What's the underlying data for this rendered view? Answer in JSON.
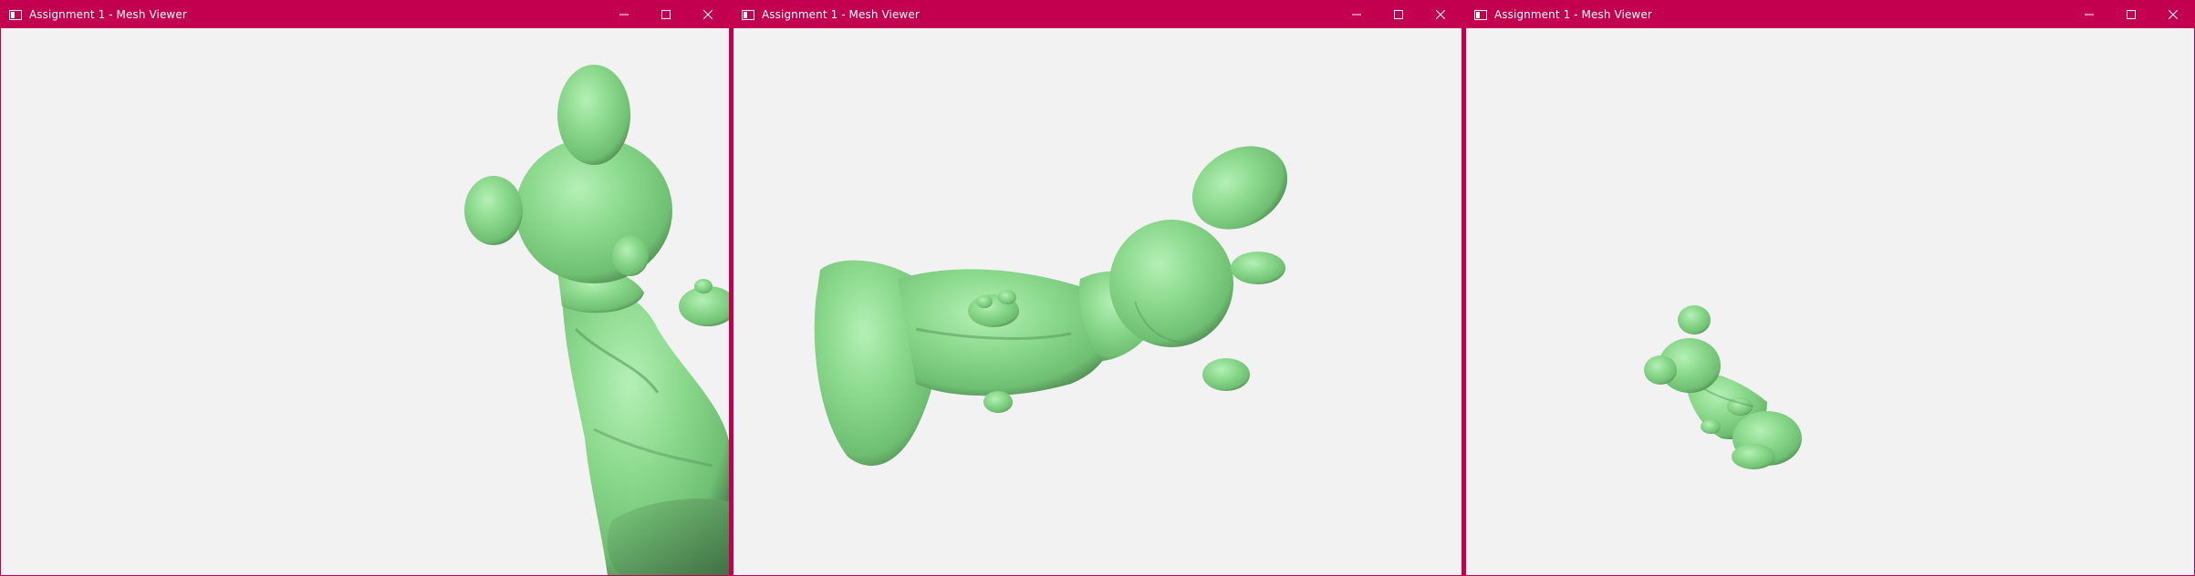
{
  "windows": [
    {
      "title": "Assignment 1 - Mesh Viewer"
    },
    {
      "title": "Assignment 1 - Mesh Viewer"
    },
    {
      "title": "Assignment 1 - Mesh Viewer"
    }
  ],
  "colors": {
    "titlebar": "#c2004f",
    "viewport_background": "#f2f2f2",
    "mesh": "#86d88a",
    "mesh_shadow": "#4f8a52"
  },
  "icons": {
    "app": "app-window-icon",
    "minimize": "minimize-icon",
    "maximize": "maximize-icon",
    "close": "close-icon"
  }
}
